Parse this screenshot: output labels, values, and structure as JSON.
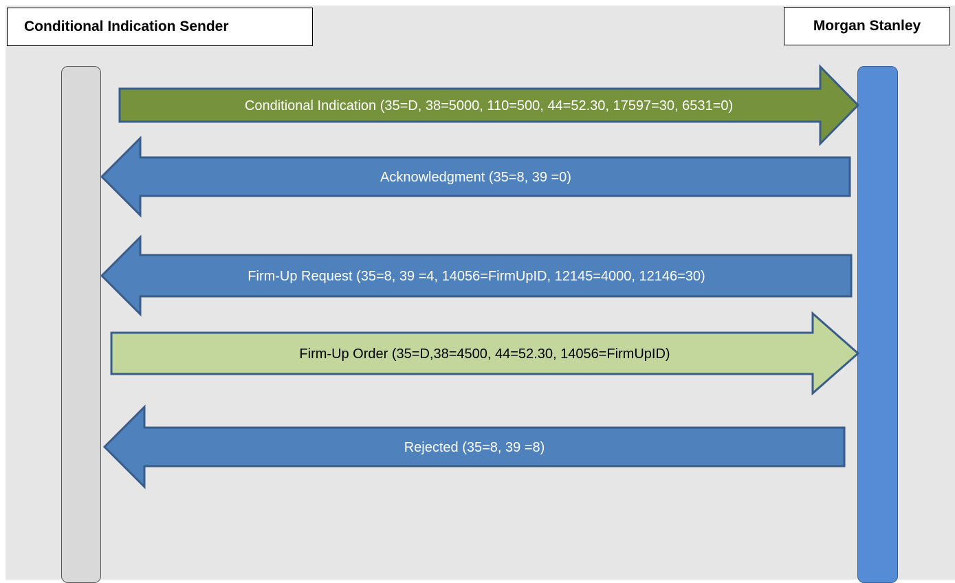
{
  "actors": {
    "left": "Conditional Indication Sender",
    "right": "Morgan Stanley"
  },
  "messages": [
    {
      "label": "Conditional Indication (35=D, 38=5000, 110=500, 44=52.30, 17597=30, 6531=0)",
      "direction": "right",
      "fill": "#76923c",
      "text_color": "#ffffff"
    },
    {
      "label": "Acknowledgment  (35=8, 39 =0)",
      "direction": "left",
      "fill": "#4f81bd",
      "text_color": "#ffffff"
    },
    {
      "label": "Firm-Up Request  (35=8, 39 =4, 14056=FirmUpID, 12145=4000, 12146=30)",
      "direction": "left",
      "fill": "#4f81bd",
      "text_color": "#ffffff"
    },
    {
      "label": "Firm-Up Order (35=D,38=4500, 44=52.30, 14056=FirmUpID)",
      "direction": "right",
      "fill": "#c3d69b",
      "text_color": "#000000"
    },
    {
      "label": "Rejected  (35=8, 39 =8)",
      "direction": "left",
      "fill": "#4f81bd",
      "text_color": "#ffffff"
    }
  ],
  "colors": {
    "background": "#e6e6e6",
    "left_lifeline": "#d9d9d9",
    "right_lifeline": "#568cd6",
    "arrow_outline": "#385d8a"
  }
}
